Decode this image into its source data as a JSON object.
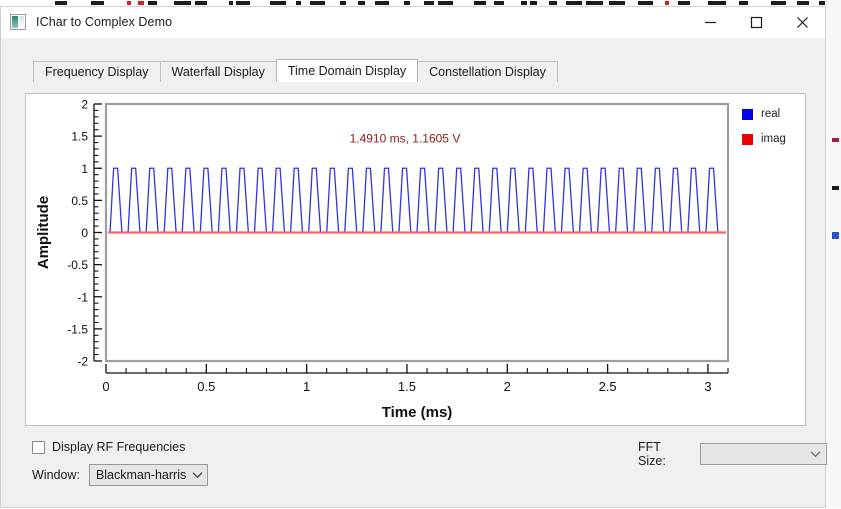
{
  "window": {
    "title": "IChar to Complex Demo",
    "icon": "app-icon",
    "buttons": {
      "minimize": "minimize-icon",
      "maximize": "maximize-icon",
      "close": "close-icon"
    }
  },
  "tabs": [
    {
      "label": "Frequency Display",
      "active": false
    },
    {
      "label": "Waterfall Display",
      "active": false
    },
    {
      "label": "Time Domain Display",
      "active": true
    },
    {
      "label": "Constellation Display",
      "active": false
    }
  ],
  "legend": [
    {
      "label": "real",
      "color": "#0000ee"
    },
    {
      "label": "imag",
      "color": "#ee0000"
    }
  ],
  "controls": {
    "rf_checkbox_label": "Display RF Frequencies",
    "rf_checkbox_checked": false,
    "window_label": "Window:",
    "window_value": "Blackman-harris",
    "fft_label": "FFT Size:",
    "fft_value": ""
  },
  "chart_data": {
    "type": "line",
    "title": "",
    "xlabel": "Time (ms)",
    "ylabel": "Amplitude",
    "xlim": [
      0,
      3.1
    ],
    "ylim": [
      -2,
      2
    ],
    "xticks": [
      0,
      0.5,
      1,
      1.5,
      2,
      2.5,
      3
    ],
    "xtick_labels": [
      "0",
      "0.5",
      "1",
      "1.5",
      "2",
      "2.5",
      "3"
    ],
    "yticks": [
      -2,
      -1.5,
      -1,
      -0.5,
      0,
      0.5,
      1,
      1.5,
      2
    ],
    "ytick_labels": [
      "-2",
      "-1.5",
      "-1",
      "-0.5",
      "0",
      "0.5",
      "1",
      "1.5",
      "2"
    ],
    "x_minor_per_major": 5,
    "y_minor_per_major": 5,
    "grid": false,
    "legend_position": "outside-right-top",
    "annotation": {
      "text": "1.4910 ms, 1.1605 V",
      "color": "#8b1a1a",
      "x": 1.49,
      "y": 1.4
    },
    "series": [
      {
        "name": "real",
        "color": "#3333dd",
        "waveform": "trapezoid-pulse",
        "low": 0.0,
        "high": 1.0,
        "cycles": 34,
        "duty_top": 0.22,
        "rise_fraction": 0.2,
        "fall_fraction": 0.24
      },
      {
        "name": "imag",
        "color": "#f26a6a",
        "waveform": "constant",
        "value": 0.0
      }
    ]
  }
}
